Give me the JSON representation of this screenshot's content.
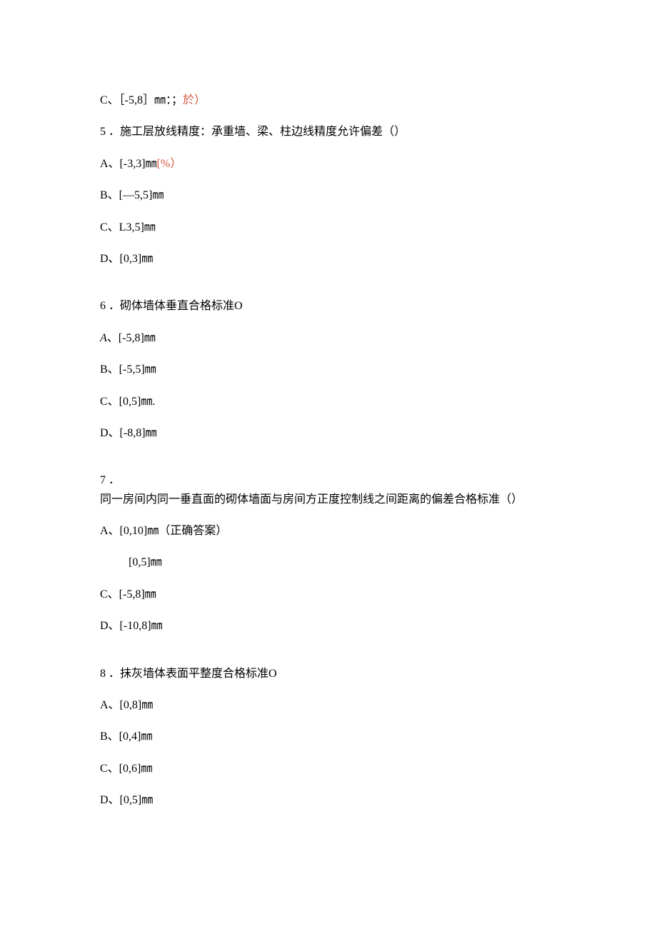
{
  "lines": {
    "q4_c_prefix": "C、［-5,8］㎜：；",
    "q4_c_suffix": "於）",
    "q5_title": "5 ．施工层放线精度：承重墙、梁、柱边线精度允许偏差（）",
    "q5_a_prefix": "A、[-3,3]㎜",
    "q5_a_suffix": "[%）",
    "q5_b": "B、[—5,5]㎜",
    "q5_c": "C、L3,5]㎜",
    "q5_d": "D、[0,3]㎜",
    "q6_title": "6 ．砌体墙体垂直合格标准O",
    "q6_a_label": "A",
    "q6_a_rest": "、[-5,8]㎜",
    "q6_b": "B、[-5,5]㎜",
    "q6_c": "C、[0,5]㎜.",
    "q6_d": "D、[-8,8]㎜",
    "q7_num": "7 ．",
    "q7_title": "同一房间内同一垂直面的砌体墙面与房间方正度控制线之间距离的偏差合格标准（）",
    "q7_a": "A、[0,10]㎜（正确答案）",
    "q7_b": "[0,5]㎜",
    "q7_c": "C、[-5,8]㎜",
    "q7_d": "D、[-10,8]㎜",
    "q8_title": "8 ．抹灰墙体表面平整度合格标准O",
    "q8_a": "A、[0,8]㎜",
    "q8_b": "B、[0,4]㎜",
    "q8_c": "C、[0,6]㎜",
    "q8_d": "D、[0,5]㎜"
  }
}
